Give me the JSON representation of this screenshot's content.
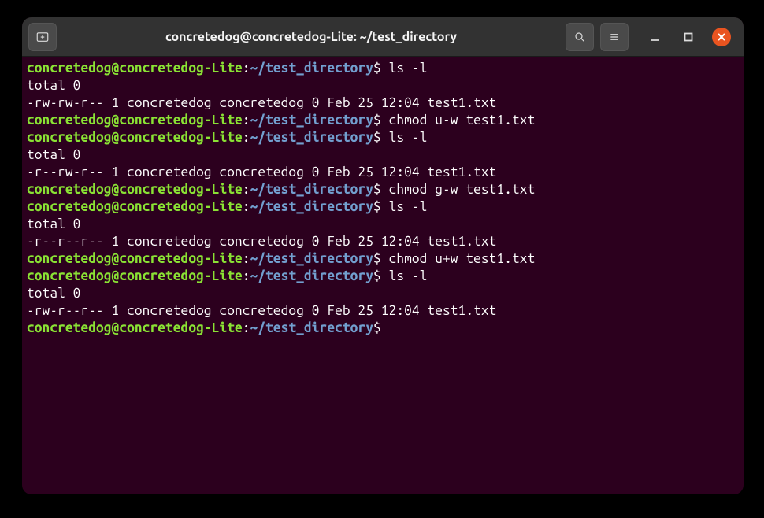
{
  "titlebar": {
    "title": "concretedog@concretedog-Lite: ~/test_directory"
  },
  "prompt": {
    "userhost": "concretedog@concretedog-Lite",
    "colon": ":",
    "path": "~/test_directory",
    "dollar": "$"
  },
  "lines": [
    {
      "type": "prompt",
      "cmd": "ls -l"
    },
    {
      "type": "output",
      "text": "total 0"
    },
    {
      "type": "output",
      "text": "-rw-rw-r-- 1 concretedog concretedog 0 Feb 25 12:04 test1.txt"
    },
    {
      "type": "prompt",
      "cmd": "chmod u-w test1.txt"
    },
    {
      "type": "prompt",
      "cmd": "ls -l"
    },
    {
      "type": "output",
      "text": "total 0"
    },
    {
      "type": "output",
      "text": "-r--rw-r-- 1 concretedog concretedog 0 Feb 25 12:04 test1.txt"
    },
    {
      "type": "prompt",
      "cmd": "chmod g-w test1.txt"
    },
    {
      "type": "prompt",
      "cmd": "ls -l"
    },
    {
      "type": "output",
      "text": "total 0"
    },
    {
      "type": "output",
      "text": "-r--r--r-- 1 concretedog concretedog 0 Feb 25 12:04 test1.txt"
    },
    {
      "type": "prompt",
      "cmd": "chmod u+w test1.txt"
    },
    {
      "type": "prompt",
      "cmd": "ls -l"
    },
    {
      "type": "output",
      "text": "total 0"
    },
    {
      "type": "output",
      "text": "-rw-r--r-- 1 concretedog concretedog 0 Feb 25 12:04 test1.txt"
    },
    {
      "type": "prompt",
      "cmd": ""
    }
  ]
}
